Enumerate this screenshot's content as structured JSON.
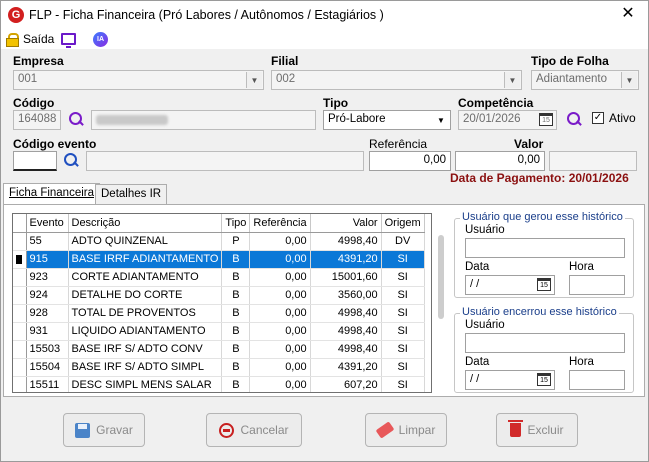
{
  "window": {
    "title": "FLP - Ficha Financeira (Pró Labores / Autônomos / Estagiários )",
    "app_icon": "G"
  },
  "toolbar": {
    "exit_label": "Saída",
    "ia_label": "IA"
  },
  "form": {
    "empresa": {
      "label": "Empresa",
      "value": "001"
    },
    "filial": {
      "label": "Filial",
      "value": "002"
    },
    "tipo_folha": {
      "label": "Tipo de Folha",
      "value": "Adiantamento"
    },
    "codigo": {
      "label": "Código",
      "value": "164088"
    },
    "tipo": {
      "label": "Tipo",
      "value": "Pró-Labore"
    },
    "competencia": {
      "label": "Competência",
      "value": "20/01/2026"
    },
    "ativo": {
      "label": "Ativo",
      "checked": true
    },
    "codigo_evento": {
      "label": "Código evento",
      "value": ""
    },
    "referencia": {
      "label": "Referência",
      "value": "0,00"
    },
    "valor": {
      "label": "Valor",
      "value": "0,00"
    },
    "data_pagamento": "Data de Pagamento: 20/01/2026"
  },
  "tabs": [
    {
      "label": "Ficha Financeira",
      "active": true
    },
    {
      "label": "Detalhes IR",
      "active": false
    }
  ],
  "grid": {
    "columns": [
      "Evento",
      "Descrição",
      "Tipo",
      "Referência",
      "Valor",
      "Origem"
    ],
    "rows": [
      {
        "evento": "55",
        "descricao": "ADTO QUINZENAL",
        "tipo": "P",
        "referencia": "0,00",
        "valor": "4998,40",
        "origem": "DV"
      },
      {
        "evento": "915",
        "descricao": "BASE IRRF ADIANTAMENTO",
        "tipo": "B",
        "referencia": "0,00",
        "valor": "4391,20",
        "origem": "SI"
      },
      {
        "evento": "923",
        "descricao": "CORTE ADIANTAMENTO",
        "tipo": "B",
        "referencia": "0,00",
        "valor": "15001,60",
        "origem": "SI"
      },
      {
        "evento": "924",
        "descricao": "DETALHE DO CORTE",
        "tipo": "B",
        "referencia": "0,00",
        "valor": "3560,00",
        "origem": "SI"
      },
      {
        "evento": "928",
        "descricao": "TOTAL DE PROVENTOS",
        "tipo": "B",
        "referencia": "0,00",
        "valor": "4998,40",
        "origem": "SI"
      },
      {
        "evento": "931",
        "descricao": "LIQUIDO ADIANTAMENTO",
        "tipo": "B",
        "referencia": "0,00",
        "valor": "4998,40",
        "origem": "SI"
      },
      {
        "evento": "15503",
        "descricao": "BASE IRF S/ ADTO CONV",
        "tipo": "B",
        "referencia": "0,00",
        "valor": "4998,40",
        "origem": "SI"
      },
      {
        "evento": "15504",
        "descricao": "BASE IRF S/ ADTO SIMPL",
        "tipo": "B",
        "referencia": "0,00",
        "valor": "4391,20",
        "origem": "SI"
      },
      {
        "evento": "15511",
        "descricao": "DESC SIMPL MENS SALAR",
        "tipo": "B",
        "referencia": "0,00",
        "valor": "607,20",
        "origem": "SI"
      }
    ]
  },
  "history_created": {
    "title": "Usuário que gerou esse histórico",
    "user_label": "Usuário",
    "user_value": "",
    "date_label": "Data",
    "date_value": " / /",
    "time_label": "Hora",
    "time_value": ""
  },
  "history_closed": {
    "title": "Usuário encerrou esse histórico",
    "user_label": "Usuário",
    "user_value": "",
    "date_label": "Data",
    "date_value": " / /",
    "time_label": "Hora",
    "time_value": ""
  },
  "buttons": {
    "save": "Gravar",
    "cancel": "Cancelar",
    "clear": "Limpar",
    "delete": "Excluir"
  },
  "icons": {
    "calendar_text": "15",
    "close": "✕"
  }
}
